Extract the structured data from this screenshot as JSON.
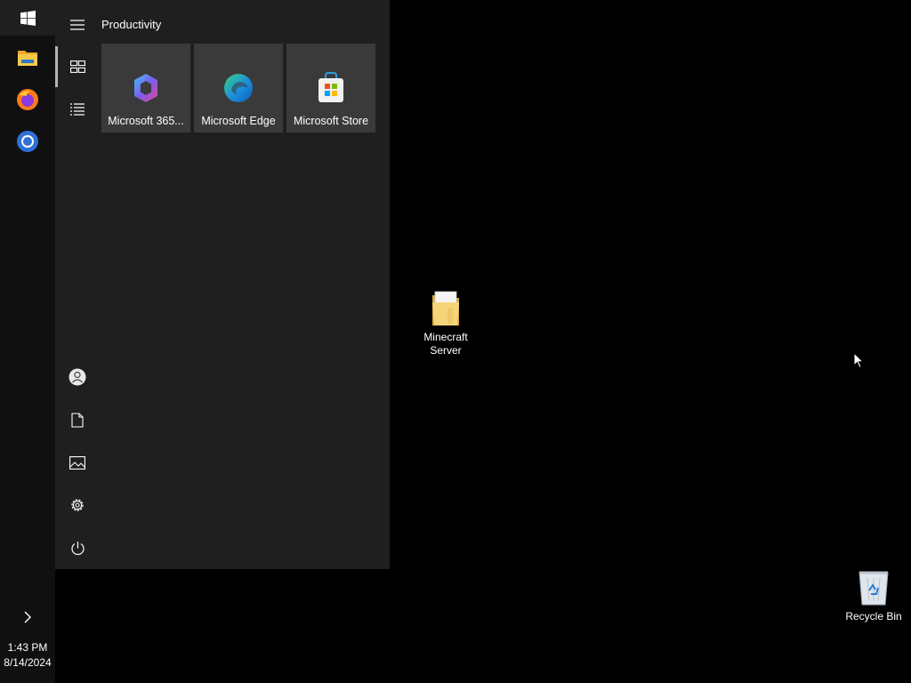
{
  "taskbar": {
    "pinned": [
      {
        "name": "File Explorer",
        "icon": "file-explorer-icon"
      },
      {
        "name": "Firefox",
        "icon": "firefox-icon"
      },
      {
        "name": "Chrome",
        "icon": "chrome-icon"
      }
    ],
    "clock": {
      "time": "1:43 PM",
      "date": "8/14/2024"
    }
  },
  "start_menu": {
    "rail": [
      {
        "icon": "hamburger-icon"
      },
      {
        "icon": "tiles-view-icon",
        "selected": true
      },
      {
        "icon": "all-apps-list-icon"
      },
      {
        "icon": "account-icon"
      },
      {
        "icon": "documents-icon"
      },
      {
        "icon": "pictures-icon"
      },
      {
        "icon": "settings-gear-icon"
      },
      {
        "icon": "power-icon"
      }
    ],
    "group_title": "Productivity",
    "tiles": [
      {
        "label": "Microsoft 365...",
        "icon": "microsoft-365-icon"
      },
      {
        "label": "Microsoft Edge",
        "icon": "edge-icon"
      },
      {
        "label": "Microsoft Store",
        "icon": "store-icon"
      }
    ]
  },
  "desktop": {
    "icons": [
      {
        "label": "Minecraft Server",
        "icon": "folder-icon"
      },
      {
        "label": "Recycle Bin",
        "icon": "recycle-bin-icon"
      }
    ]
  },
  "colors": {
    "desktop_bg": "#000000",
    "taskbar_bg": "#101010",
    "start_menu_bg": "#1f1f1f",
    "tile_bg": "#3a3a3a"
  }
}
